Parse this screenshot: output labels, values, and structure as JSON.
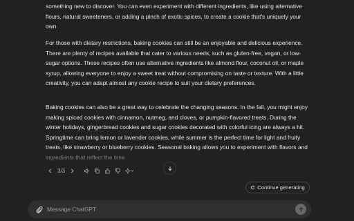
{
  "response": {
    "paragraphs": [
      "something new to discover. You can even experiment with different ingredients, like using alternative flours, natural sweeteners, or adding a pinch of exotic spices, to create a cookie that's uniquely your own.",
      "For those with dietary restrictions, baking cookies can still be an enjoyable and delicious experience. There are plenty of recipes available that cater to various needs, such as gluten-free, vegan, or low-sugar options. These recipes often use alternative ingredients like almond flour, coconut oil, or maple syrup, allowing everyone to enjoy a sweet treat without compromising on taste or texture. With a little creativity, you can adapt almost any cookie recipe to suit your dietary preferences.",
      "Baking cookies can also be a great way to celebrate the changing seasons. In the fall, you might enjoy making spiced cookies with cinnamon, nutmeg, and cloves, or pumpkin-flavored treats. During the winter holidays, gingerbread cookies and sugar cookies decorated with colorful icing are always a hit. Springtime can bring lemon or lavender cookies, while summer is the perfect time for light and fruity treats, like strawberry or blueberry cookies. Seasonal baking allows you to experiment with flavors and ingredients that reflect the time"
    ]
  },
  "actions": {
    "pagination": "3/3",
    "icons": [
      "chevron-left-icon",
      "chevron-right-icon",
      "speaker-icon",
      "copy-icon",
      "thumbs-up-icon",
      "thumbs-down-icon",
      "sparkle-icon",
      "chevron-down-icon"
    ]
  },
  "continue_button": {
    "label": "Continue generating"
  },
  "composer": {
    "placeholder": "Message ChatGPT"
  }
}
